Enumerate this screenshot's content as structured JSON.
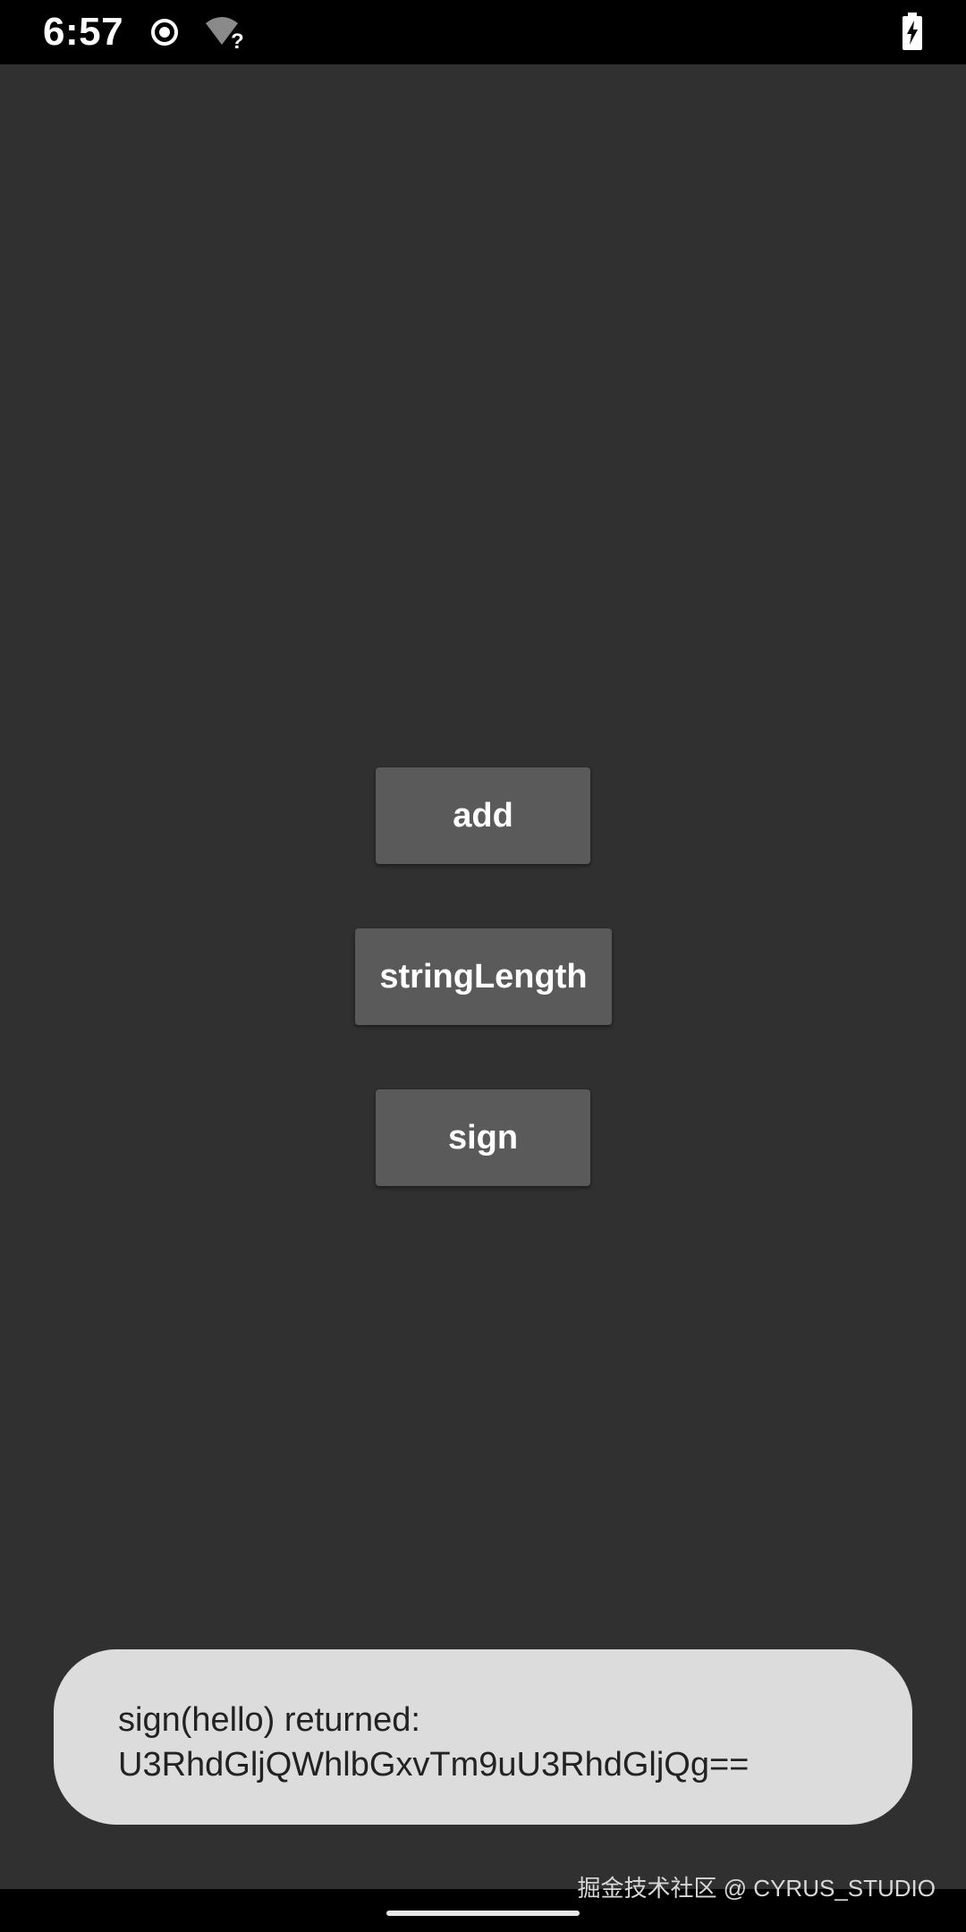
{
  "status_bar": {
    "time": "6:57",
    "icons": [
      "record-icon",
      "wifi-unknown-icon",
      "battery-charging-icon"
    ],
    "wifi_symbol": "?"
  },
  "buttons": {
    "add": "add",
    "string_length": "stringLength",
    "sign": "sign"
  },
  "toast": {
    "line1": "sign(hello) returned:",
    "line2": "U3RhdGljQWhlbGxvTm9uU3RhdGljQg=="
  },
  "watermark": "掘金技术社区 @ CYRUS_STUDIO",
  "colors": {
    "background": "#303030",
    "button": "#5a5a5a",
    "toast": "#dcdcdc",
    "status_bar": "#000000"
  }
}
